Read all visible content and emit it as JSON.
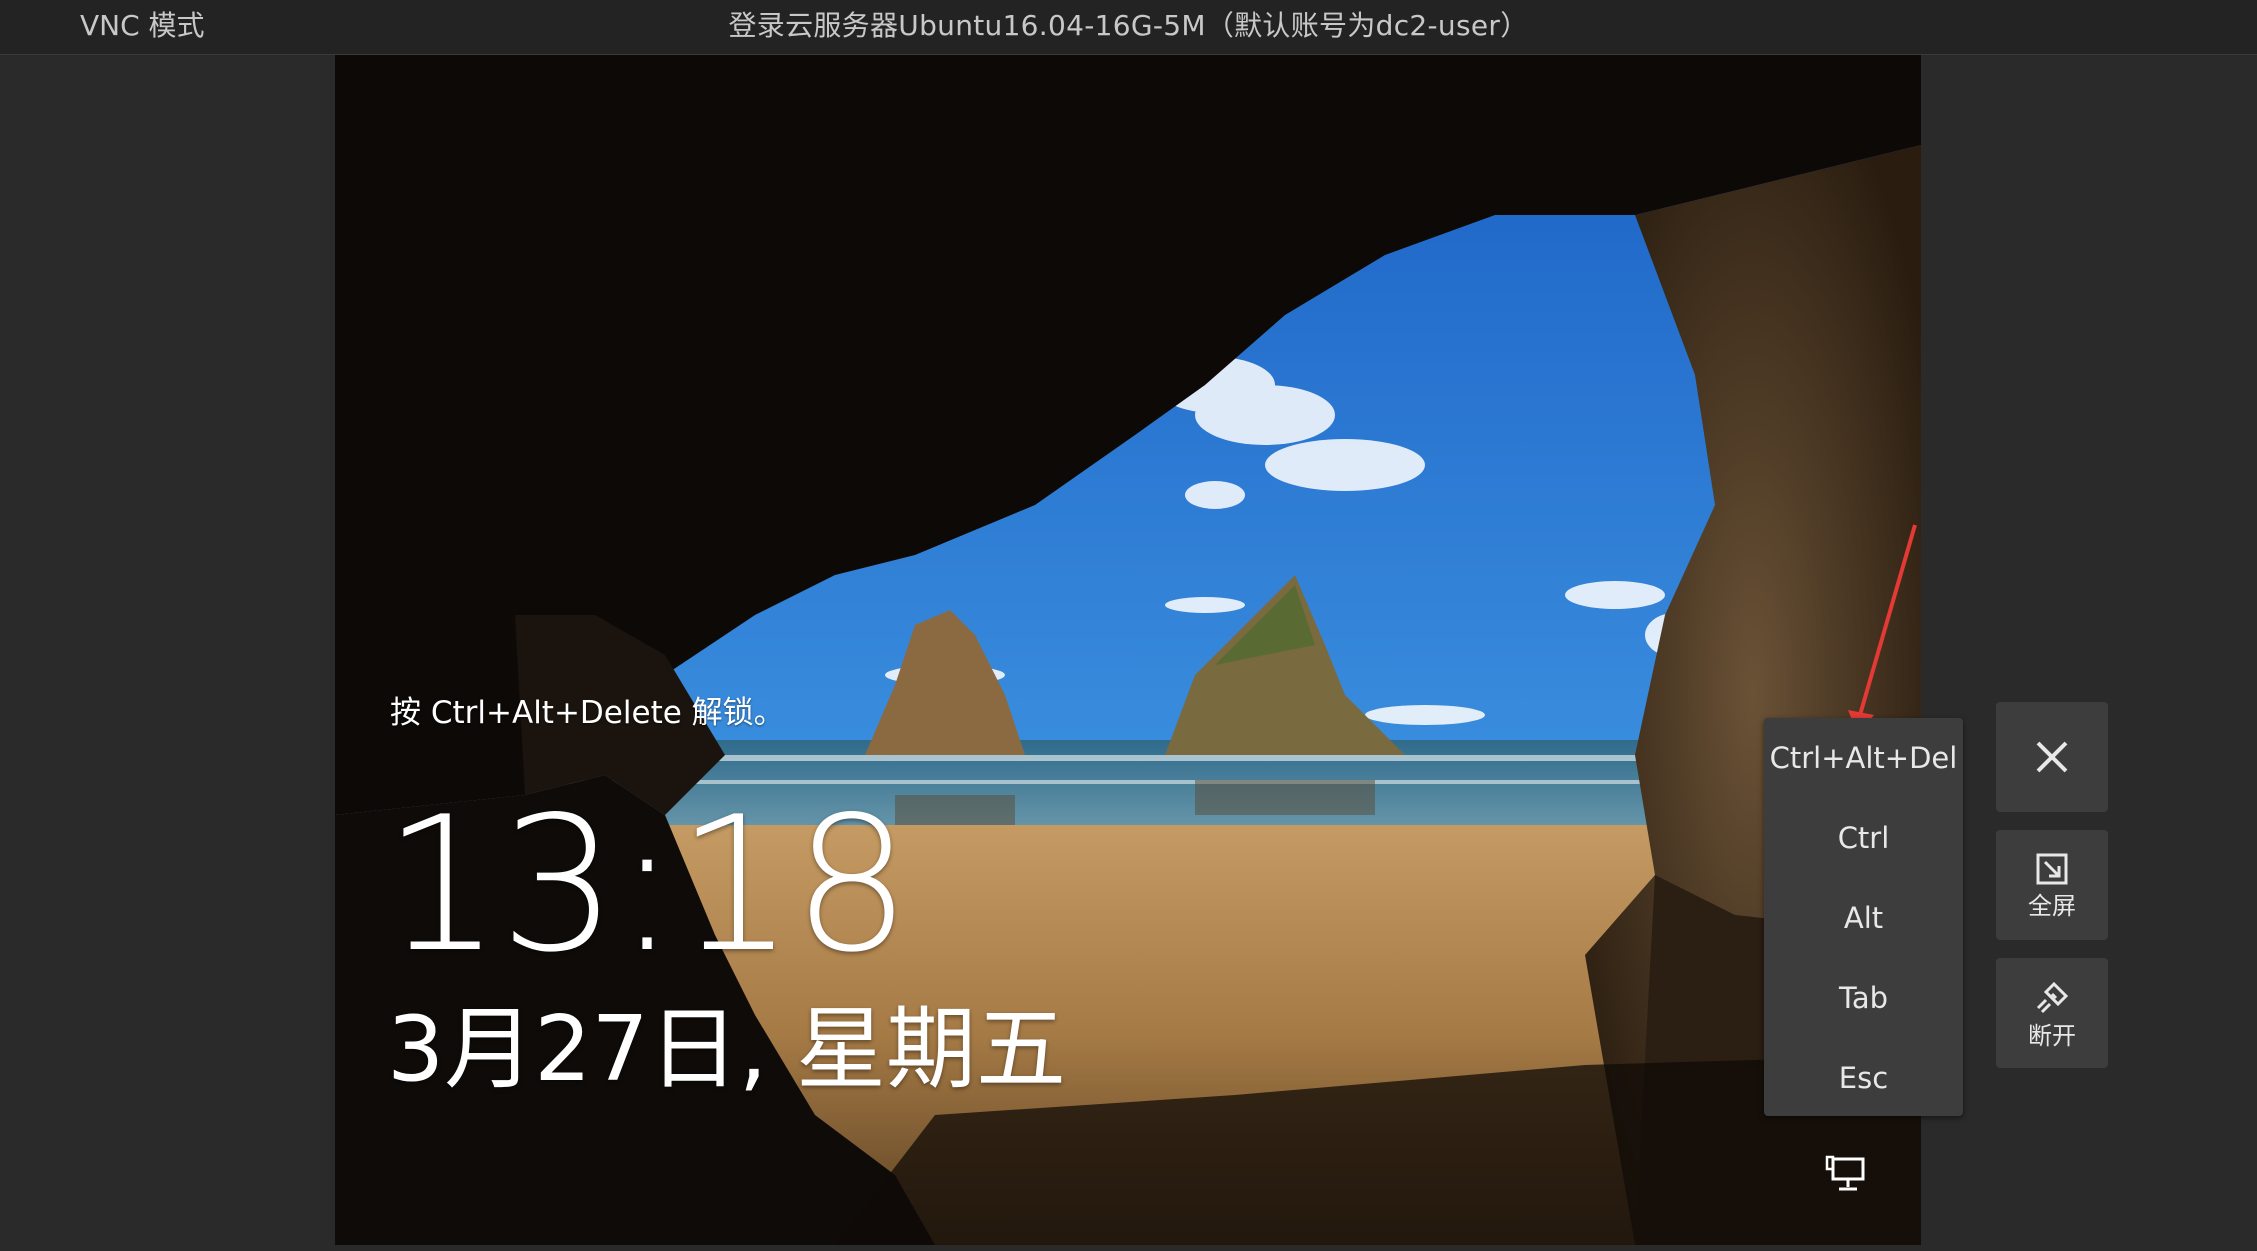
{
  "topbar": {
    "mode_label": "VNC 模式",
    "title": "登录云服务器Ubuntu16.04-16G-5M（默认账号为dc2-user）"
  },
  "lockscreen": {
    "unlock_hint": "按 Ctrl+Alt+Delete 解锁。",
    "time": "13:18",
    "date": "3月27日, 星期五"
  },
  "keys_menu": {
    "items": [
      {
        "label": "Ctrl+Alt+Del"
      },
      {
        "label": "Ctrl"
      },
      {
        "label": "Alt"
      },
      {
        "label": "Tab"
      },
      {
        "label": "Esc"
      }
    ]
  },
  "side_buttons": {
    "close_icon": "close-icon",
    "fullscreen_label": "全屏",
    "fullscreen_icon": "fullscreen-icon",
    "disconnect_label": "断开",
    "disconnect_icon": "disconnect-icon"
  },
  "colors": {
    "topbar_bg": "#232323",
    "page_bg": "#2a2a2a",
    "panel_bg": "#3d3d3d",
    "annotation_arrow": "#e53935"
  }
}
